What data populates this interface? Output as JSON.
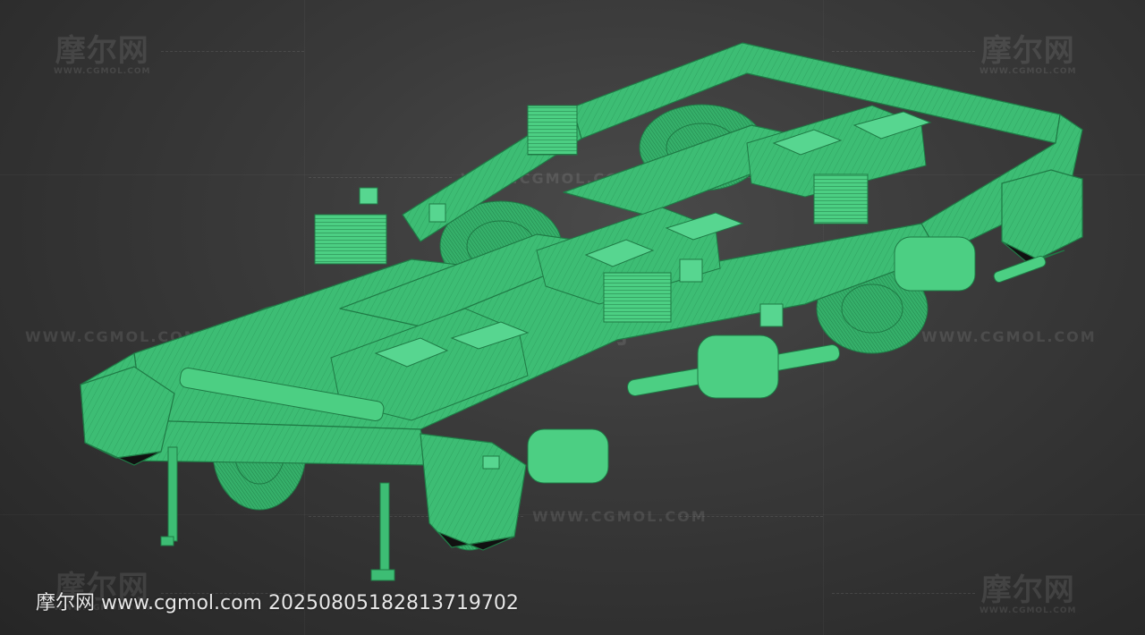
{
  "caption": {
    "text": "摩尔网 www.cgmol.com 20250805182813719702"
  },
  "watermark": {
    "logo_cn": "摩尔网",
    "logo_en": "WWW.CGMOL.COM",
    "url": "WWW.CGMOL.COM"
  },
  "colors": {
    "mesh_fill": "#3dbd74",
    "mesh_light": "#57d690",
    "mesh_dark": "#1f7a45",
    "background": "#2b2b2b"
  }
}
